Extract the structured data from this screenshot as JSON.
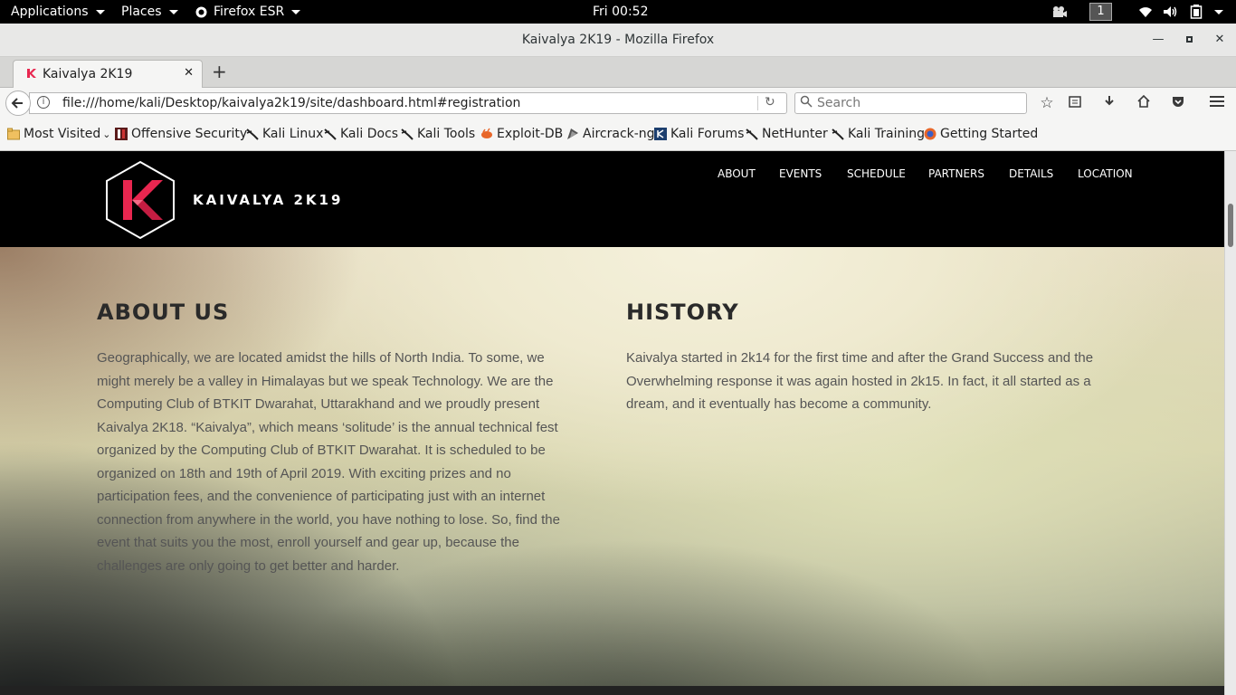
{
  "topbar": {
    "applications": "Applications",
    "places": "Places",
    "firefox": "Firefox ESR",
    "clock": "Fri 00:52",
    "workspace": "1"
  },
  "window": {
    "title": "Kaivalya 2K19 - Mozilla Firefox"
  },
  "tabs": [
    {
      "label": "Kaivalya 2K19"
    }
  ],
  "nav": {
    "url": "file:///home/kali/Desktop/kaivalya2k19/site/dashboard.html#registration",
    "search_placeholder": "Search"
  },
  "bookmarks": [
    {
      "label": "Most Visited",
      "icon": "folder-icon"
    },
    {
      "label": "Offensive Security",
      "icon": "offsec-icon"
    },
    {
      "label": "Kali Linux",
      "icon": "kali-dragon-icon"
    },
    {
      "label": "Kali Docs",
      "icon": "kali-dragon-icon"
    },
    {
      "label": "Kali Tools",
      "icon": "kali-dragon-icon"
    },
    {
      "label": "Exploit-DB",
      "icon": "exploitdb-icon"
    },
    {
      "label": "Aircrack-ng",
      "icon": "aircrack-icon"
    },
    {
      "label": "Kali Forums",
      "icon": "kali-forums-icon"
    },
    {
      "label": "NetHunter",
      "icon": "kali-dragon-icon"
    },
    {
      "label": "Kali Training",
      "icon": "kali-dragon-icon"
    },
    {
      "label": "Getting Started",
      "icon": "firefox-icon"
    }
  ],
  "site": {
    "brand": "KAIVALYA 2K19",
    "menu": [
      "ABOUT",
      "EVENTS",
      "SCHEDULE",
      "PARTNERS",
      "DETAILS",
      "LOCATION"
    ],
    "about_title": "ABOUT US",
    "about_lines": [
      "Geographically, we are located amidst the hills of North India. To some, we",
      "might merely be a valley in Himalayas but we speak Technology. We are the",
      "Computing Club of BTKIT Dwarahat, Uttarakhand and we proudly present",
      "Kaivalya 2K18. “Kaivalya”, which means ‘solitude’ is the annual technical fest",
      "organized by the Computing Club of BTKIT Dwarahat. It is scheduled to be",
      "organized on 18th and 19th of April 2019. With exciting prizes and no",
      "participation fees, and the convenience of participating just with an internet",
      "connection from anywhere in the world, you have nothing to lose. So, find the",
      "event that suits you the most, enroll yourself and gear up, because the",
      "challenges are only going to get better and harder."
    ],
    "history_title": "HISTORY",
    "history_lines": [
      "Kaivalya started in 2k14 for the first time and after the Grand Success and the",
      "Overwhelming response it was again hosted in 2k15. In fact, it all started as a",
      "dream, and it eventually has become a community."
    ],
    "logo_letter": "K",
    "accent": "#e8264f"
  }
}
